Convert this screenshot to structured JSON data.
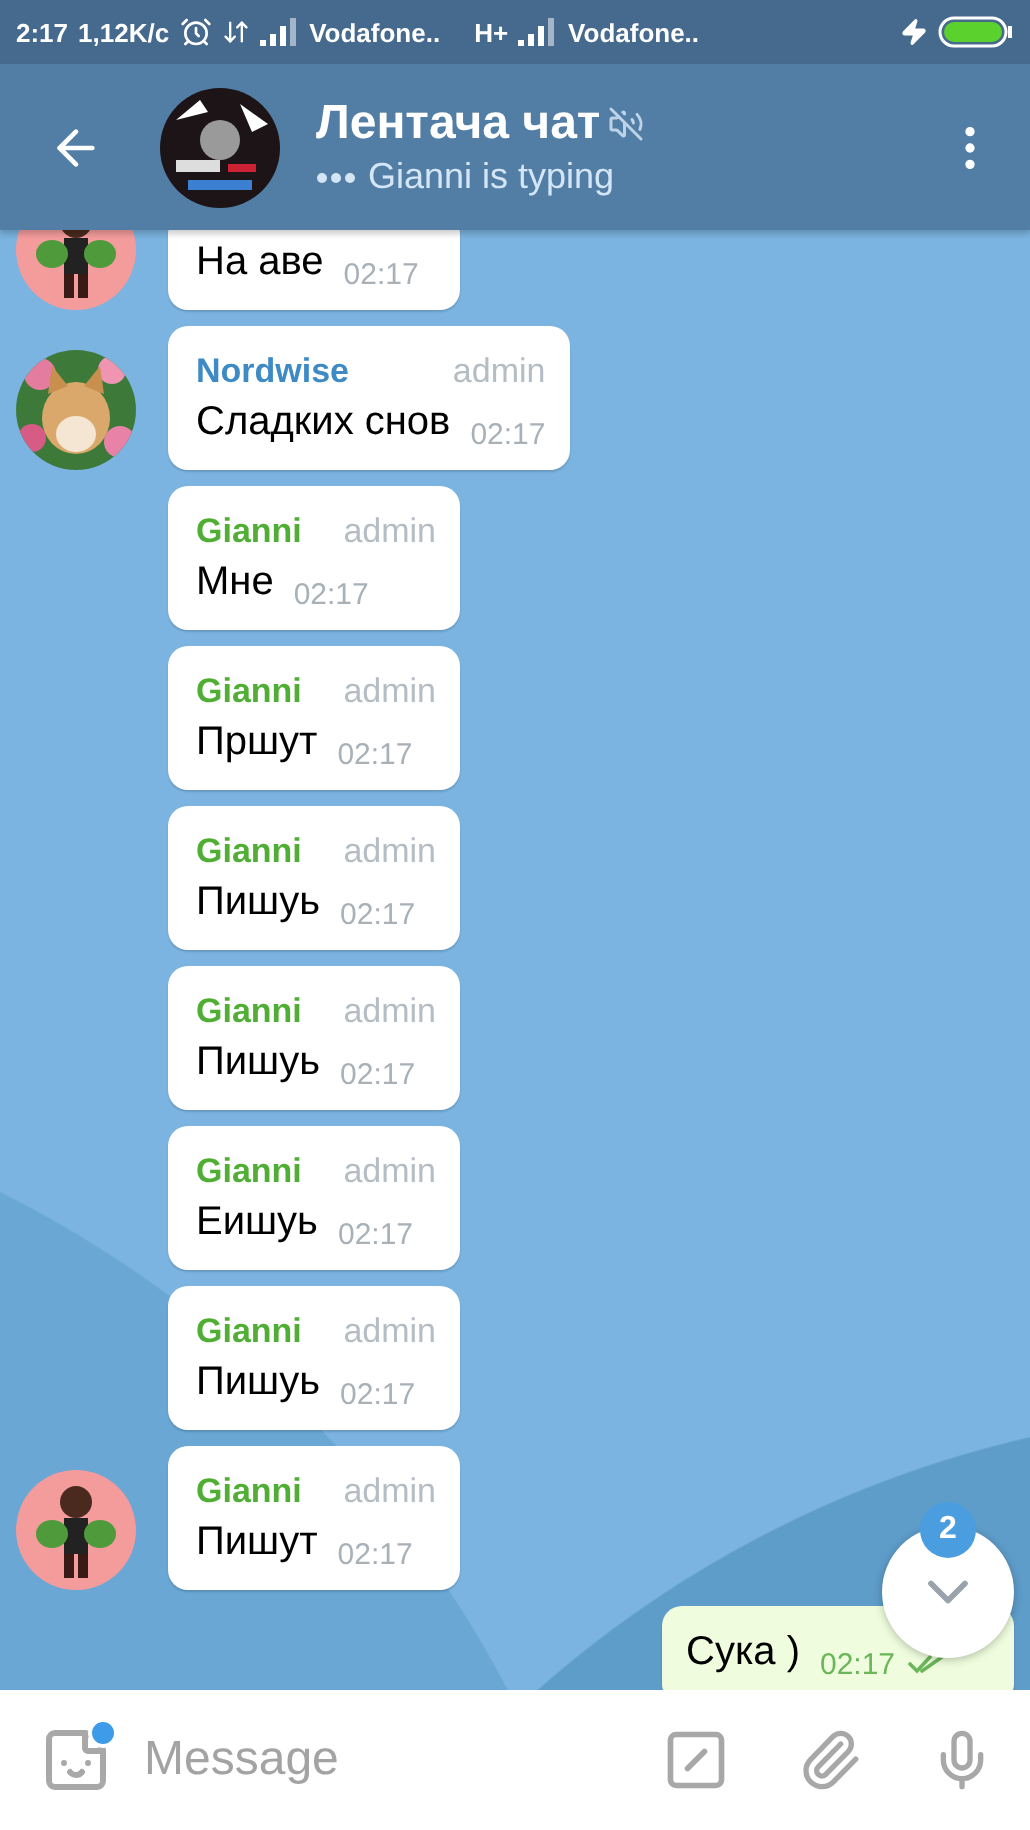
{
  "status_bar": {
    "time": "2:17",
    "speed": "1,12K/с",
    "carriers": [
      {
        "name": "Vodafone.."
      },
      {
        "network": "H+",
        "name": "Vodafone.."
      }
    ],
    "charging": true
  },
  "header": {
    "title": "Лентача чат",
    "muted": true,
    "status": "Gianni is typing"
  },
  "messages": [
    {
      "kind": "incoming",
      "text": "На аве",
      "time": "02:17",
      "avatar": true,
      "clipped": true
    },
    {
      "kind": "incoming",
      "sender": "Nordwise",
      "color": "#3d8ac4",
      "role": "admin",
      "text": "Сладких снов",
      "time": "02:17",
      "avatar": true
    },
    {
      "kind": "incoming",
      "sender": "Gianni",
      "color": "#4fae33",
      "role": "admin",
      "text": "Мне",
      "time": "02:17",
      "avatar": false
    },
    {
      "kind": "incoming",
      "sender": "Gianni",
      "color": "#4fae33",
      "role": "admin",
      "text": "Пршут",
      "time": "02:17",
      "avatar": false
    },
    {
      "kind": "incoming",
      "sender": "Gianni",
      "color": "#4fae33",
      "role": "admin",
      "text": "Пишуь",
      "time": "02:17",
      "avatar": false
    },
    {
      "kind": "incoming",
      "sender": "Gianni",
      "color": "#4fae33",
      "role": "admin",
      "text": "Пишуь",
      "time": "02:17",
      "avatar": false
    },
    {
      "kind": "incoming",
      "sender": "Gianni",
      "color": "#4fae33",
      "role": "admin",
      "text": "Еишуь",
      "time": "02:17",
      "avatar": false
    },
    {
      "kind": "incoming",
      "sender": "Gianni",
      "color": "#4fae33",
      "role": "admin",
      "text": "Пишуь",
      "time": "02:17",
      "avatar": false
    },
    {
      "kind": "incoming",
      "sender": "Gianni",
      "color": "#4fae33",
      "role": "admin",
      "text": "Пишут",
      "time": "02:17",
      "avatar": true
    },
    {
      "kind": "outgoing",
      "text": "Сука )",
      "time": "02:17",
      "read": true
    }
  ],
  "scroll_button": {
    "badge": "2"
  },
  "composer": {
    "placeholder": "Message",
    "sticker_notice": true
  }
}
